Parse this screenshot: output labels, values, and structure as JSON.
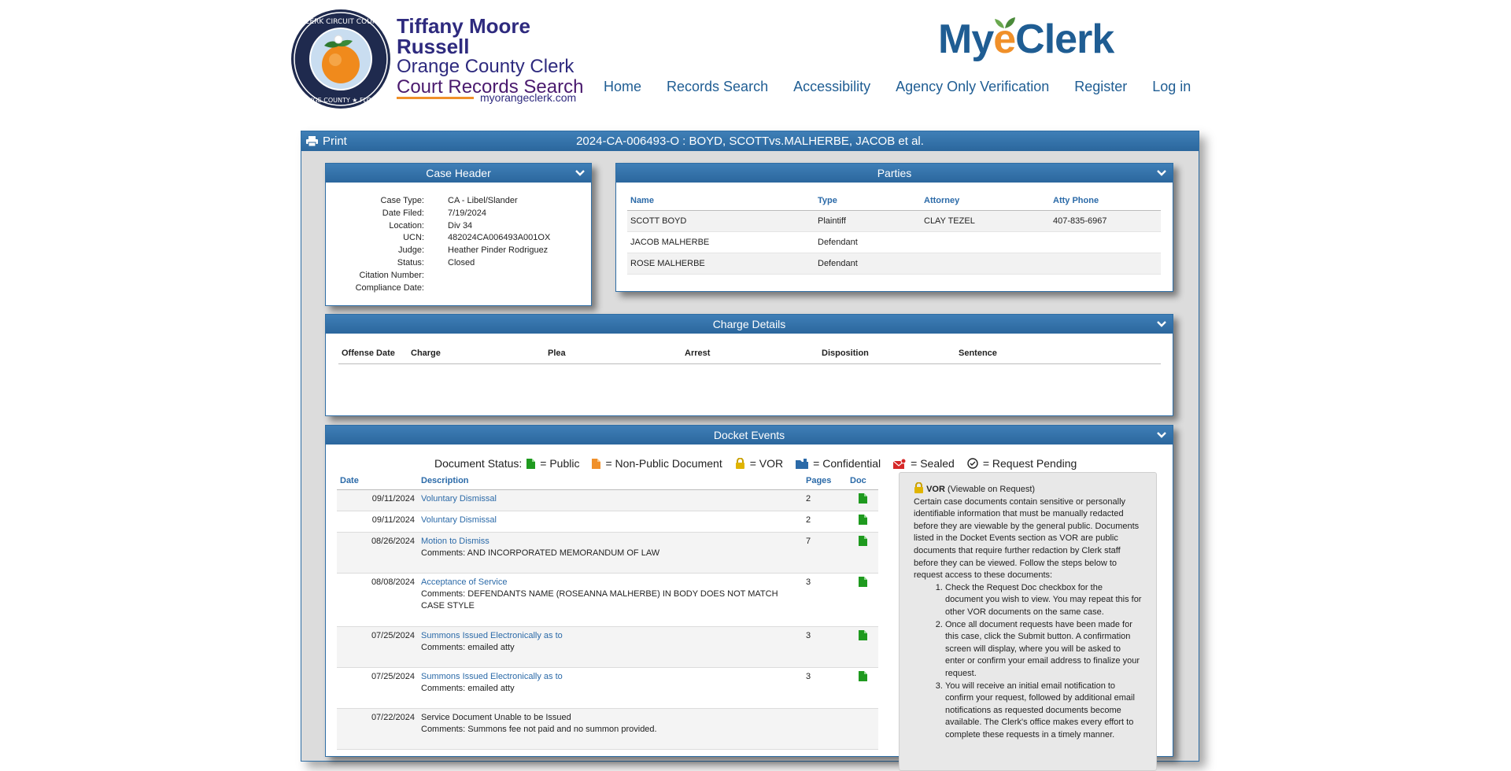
{
  "brand": {
    "line1": "Tiffany Moore Russell",
    "line2": "Orange County Clerk",
    "line3": "Court Records Search",
    "url": "myorangeclerk.com",
    "seal_text_top": "CLERK CIRCUIT COURT",
    "seal_text_bottom": "ORANGE COUNTY ★ FLORIDA"
  },
  "myeclerk": {
    "my": "My",
    "e": "e",
    "clerk": "Clerk"
  },
  "nav": [
    {
      "label": "Home"
    },
    {
      "label": "Records Search"
    },
    {
      "label": "Accessibility"
    },
    {
      "label": "Agency Only Verification"
    },
    {
      "label": "Register"
    },
    {
      "label": "Log in"
    }
  ],
  "main": {
    "print_label": "Print",
    "case_title": "2024-CA-006493-O : BOYD, SCOTTvs.MALHERBE, JACOB et al."
  },
  "case_header": {
    "title": "Case Header",
    "fields": [
      {
        "k": "Case Type:",
        "v": "CA - Libel/Slander"
      },
      {
        "k": "Date Filed:",
        "v": "7/19/2024"
      },
      {
        "k": "Location:",
        "v": "Div 34"
      },
      {
        "k": "UCN:",
        "v": "482024CA006493A001OX"
      },
      {
        "k": "Judge:",
        "v": "Heather Pinder Rodriguez"
      },
      {
        "k": "Status:",
        "v": "Closed"
      },
      {
        "k": "Citation Number:",
        "v": ""
      },
      {
        "k": "Compliance Date:",
        "v": ""
      }
    ]
  },
  "parties": {
    "title": "Parties",
    "columns": [
      "Name",
      "Type",
      "Attorney",
      "Atty Phone"
    ],
    "rows": [
      [
        "SCOTT BOYD",
        "Plaintiff",
        "CLAY TEZEL",
        "407-835-6967"
      ],
      [
        "JACOB MALHERBE",
        "Defendant",
        "",
        ""
      ],
      [
        "ROSE MALHERBE",
        "Defendant",
        "",
        ""
      ]
    ]
  },
  "charges": {
    "title": "Charge Details",
    "columns": [
      "Offense Date",
      "Charge",
      "Plea",
      "Arrest",
      "Disposition",
      "Sentence"
    ]
  },
  "docket": {
    "title": "Docket Events",
    "status_label": "Document Status:",
    "legend": [
      {
        "text": "= Public"
      },
      {
        "text": "= Non-Public Document"
      },
      {
        "text": "= VOR"
      },
      {
        "text": "= Confidential"
      },
      {
        "text": "= Sealed"
      },
      {
        "text": "= Request Pending"
      }
    ],
    "columns": [
      "Date",
      "Description",
      "Pages",
      "Doc"
    ],
    "rows": [
      {
        "date": "09/11/2024",
        "desc": "Voluntary Dismissal",
        "comment": "",
        "pages": "2",
        "doc": "public"
      },
      {
        "date": "09/11/2024",
        "desc": "Voluntary Dismissal",
        "comment": "",
        "pages": "2",
        "doc": "public"
      },
      {
        "date": "08/26/2024",
        "desc": "Motion to Dismiss",
        "comment": "Comments: AND INCORPORATED MEMORANDUM OF LAW",
        "pages": "7",
        "doc": "public"
      },
      {
        "date": "08/08/2024",
        "desc": "Acceptance of Service",
        "comment": "Comments: DEFENDANTS NAME (ROSEANNA MALHERBE) IN BODY DOES NOT MATCH CASE STYLE",
        "pages": "3",
        "doc": "public"
      },
      {
        "date": "07/25/2024",
        "desc": "Summons Issued Electronically as to",
        "comment": "Comments: emailed atty",
        "pages": "3",
        "doc": "public"
      },
      {
        "date": "07/25/2024",
        "desc": "Summons Issued Electronically as to",
        "comment": "Comments: emailed atty",
        "pages": "3",
        "doc": "public"
      },
      {
        "date": "07/22/2024",
        "desc": "Service Document Unable to be Issued",
        "comment": "Comments: Summons fee not paid and no summon provided.",
        "pages": "",
        "doc": ""
      }
    ],
    "vor": {
      "title": "VOR",
      "subtitle": "(Viewable on Request)",
      "intro": "Certain case documents contain sensitive or personally identifiable information that must be manually redacted before they are viewable by the general public. Documents listed in the Docket Events section as VOR are public documents that require further redaction by Clerk staff before they can be viewed. Follow the steps below to request access to these documents:",
      "steps": [
        "Check the Request Doc checkbox for the document you wish to view. You may repeat this for other VOR documents on the same case.",
        "Once all document requests have been made for this case, click the Submit button. A confirmation screen will display, where you will be asked to enter or confirm your email address to finalize your request.",
        "You will receive an initial email notification to confirm your request, followed by additional email notifications as requested documents become available. The Clerk's office makes every effort to complete these requests in a timely manner."
      ]
    }
  }
}
